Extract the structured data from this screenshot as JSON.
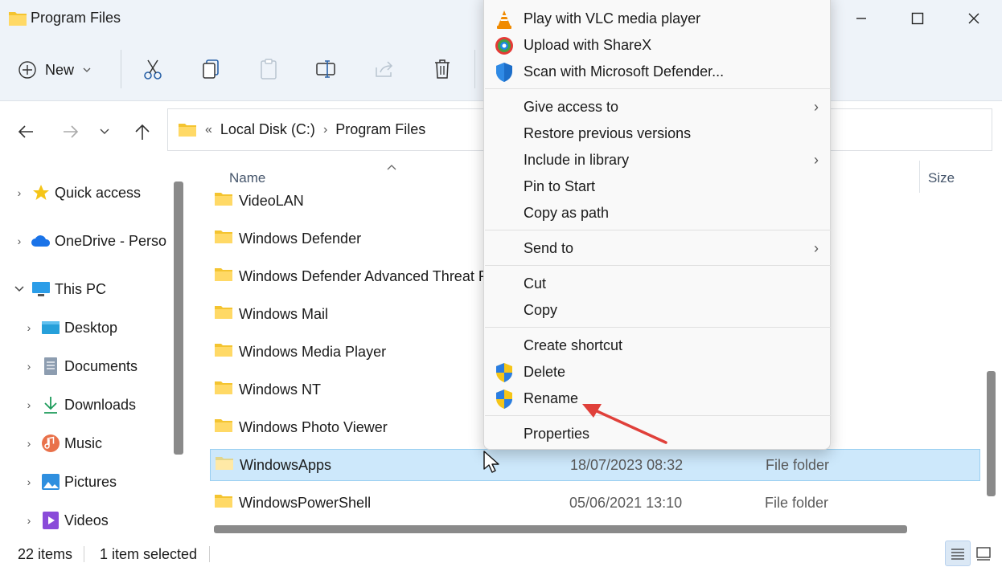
{
  "window": {
    "title": "Program Files",
    "minimize_icon": "minimize-icon",
    "maximize_icon": "maximize-icon",
    "close_icon": "close-icon"
  },
  "toolbar": {
    "new_label": "New",
    "buttons": [
      "cut-icon",
      "copy-icon",
      "paste-icon",
      "rename-icon",
      "share-icon",
      "delete-icon"
    ]
  },
  "address": {
    "overflow": "«",
    "crumbs": [
      "Local Disk (C:)",
      "Program Files"
    ]
  },
  "sidebar": {
    "items": [
      {
        "label": "Quick access",
        "icon": "star-icon"
      },
      {
        "label": "OneDrive - Perso",
        "icon": "cloud-icon"
      },
      {
        "label": "This PC",
        "icon": "monitor-icon"
      },
      {
        "label": "Desktop",
        "icon": "desktop-icon"
      },
      {
        "label": "Documents",
        "icon": "documents-icon"
      },
      {
        "label": "Downloads",
        "icon": "download-icon"
      },
      {
        "label": "Music",
        "icon": "music-icon"
      },
      {
        "label": "Pictures",
        "icon": "pictures-icon"
      },
      {
        "label": "Videos",
        "icon": "videos-icon"
      }
    ]
  },
  "columns": {
    "name": "Name",
    "size": "Size"
  },
  "files": [
    {
      "name": "VideoLAN",
      "date": "",
      "type": ""
    },
    {
      "name": "Windows Defender",
      "date": "",
      "type": ""
    },
    {
      "name": "Windows Defender Advanced Threat Protection",
      "date": "",
      "type": ""
    },
    {
      "name": "Windows Mail",
      "date": "",
      "type": ""
    },
    {
      "name": "Windows Media Player",
      "date": "",
      "type": ""
    },
    {
      "name": "Windows NT",
      "date": "",
      "type": ""
    },
    {
      "name": "Windows Photo Viewer",
      "date": "",
      "type": ""
    },
    {
      "name": "WindowsApps",
      "date": "18/07/2023 08:32",
      "type": "File folder",
      "selected": true
    },
    {
      "name": "WindowsPowerShell",
      "date": "05/06/2021 13:10",
      "type": "File folder"
    }
  ],
  "status": {
    "items": "22 items",
    "selected": "1 item selected"
  },
  "context_menu": {
    "groups": [
      [
        {
          "label": "Play with VLC media player",
          "icon": "vlc-icon"
        },
        {
          "label": "Upload with ShareX",
          "icon": "sharex-icon"
        },
        {
          "label": "Scan with Microsoft Defender...",
          "icon": "defender-shield-icon"
        }
      ],
      [
        {
          "label": "Give access to",
          "submenu": true
        },
        {
          "label": "Restore previous versions"
        },
        {
          "label": "Include in library",
          "submenu": true
        },
        {
          "label": "Pin to Start"
        },
        {
          "label": "Copy as path"
        }
      ],
      [
        {
          "label": "Send to",
          "submenu": true
        }
      ],
      [
        {
          "label": "Cut"
        },
        {
          "label": "Copy"
        }
      ],
      [
        {
          "label": "Create shortcut"
        },
        {
          "label": "Delete",
          "icon": "uac-shield-icon"
        },
        {
          "label": "Rename",
          "icon": "uac-shield-icon"
        }
      ],
      [
        {
          "label": "Properties"
        }
      ]
    ]
  },
  "colors": {
    "accent": "#0067c0",
    "selection": "#cde8fb",
    "callout_arrow": "#e0403a"
  }
}
